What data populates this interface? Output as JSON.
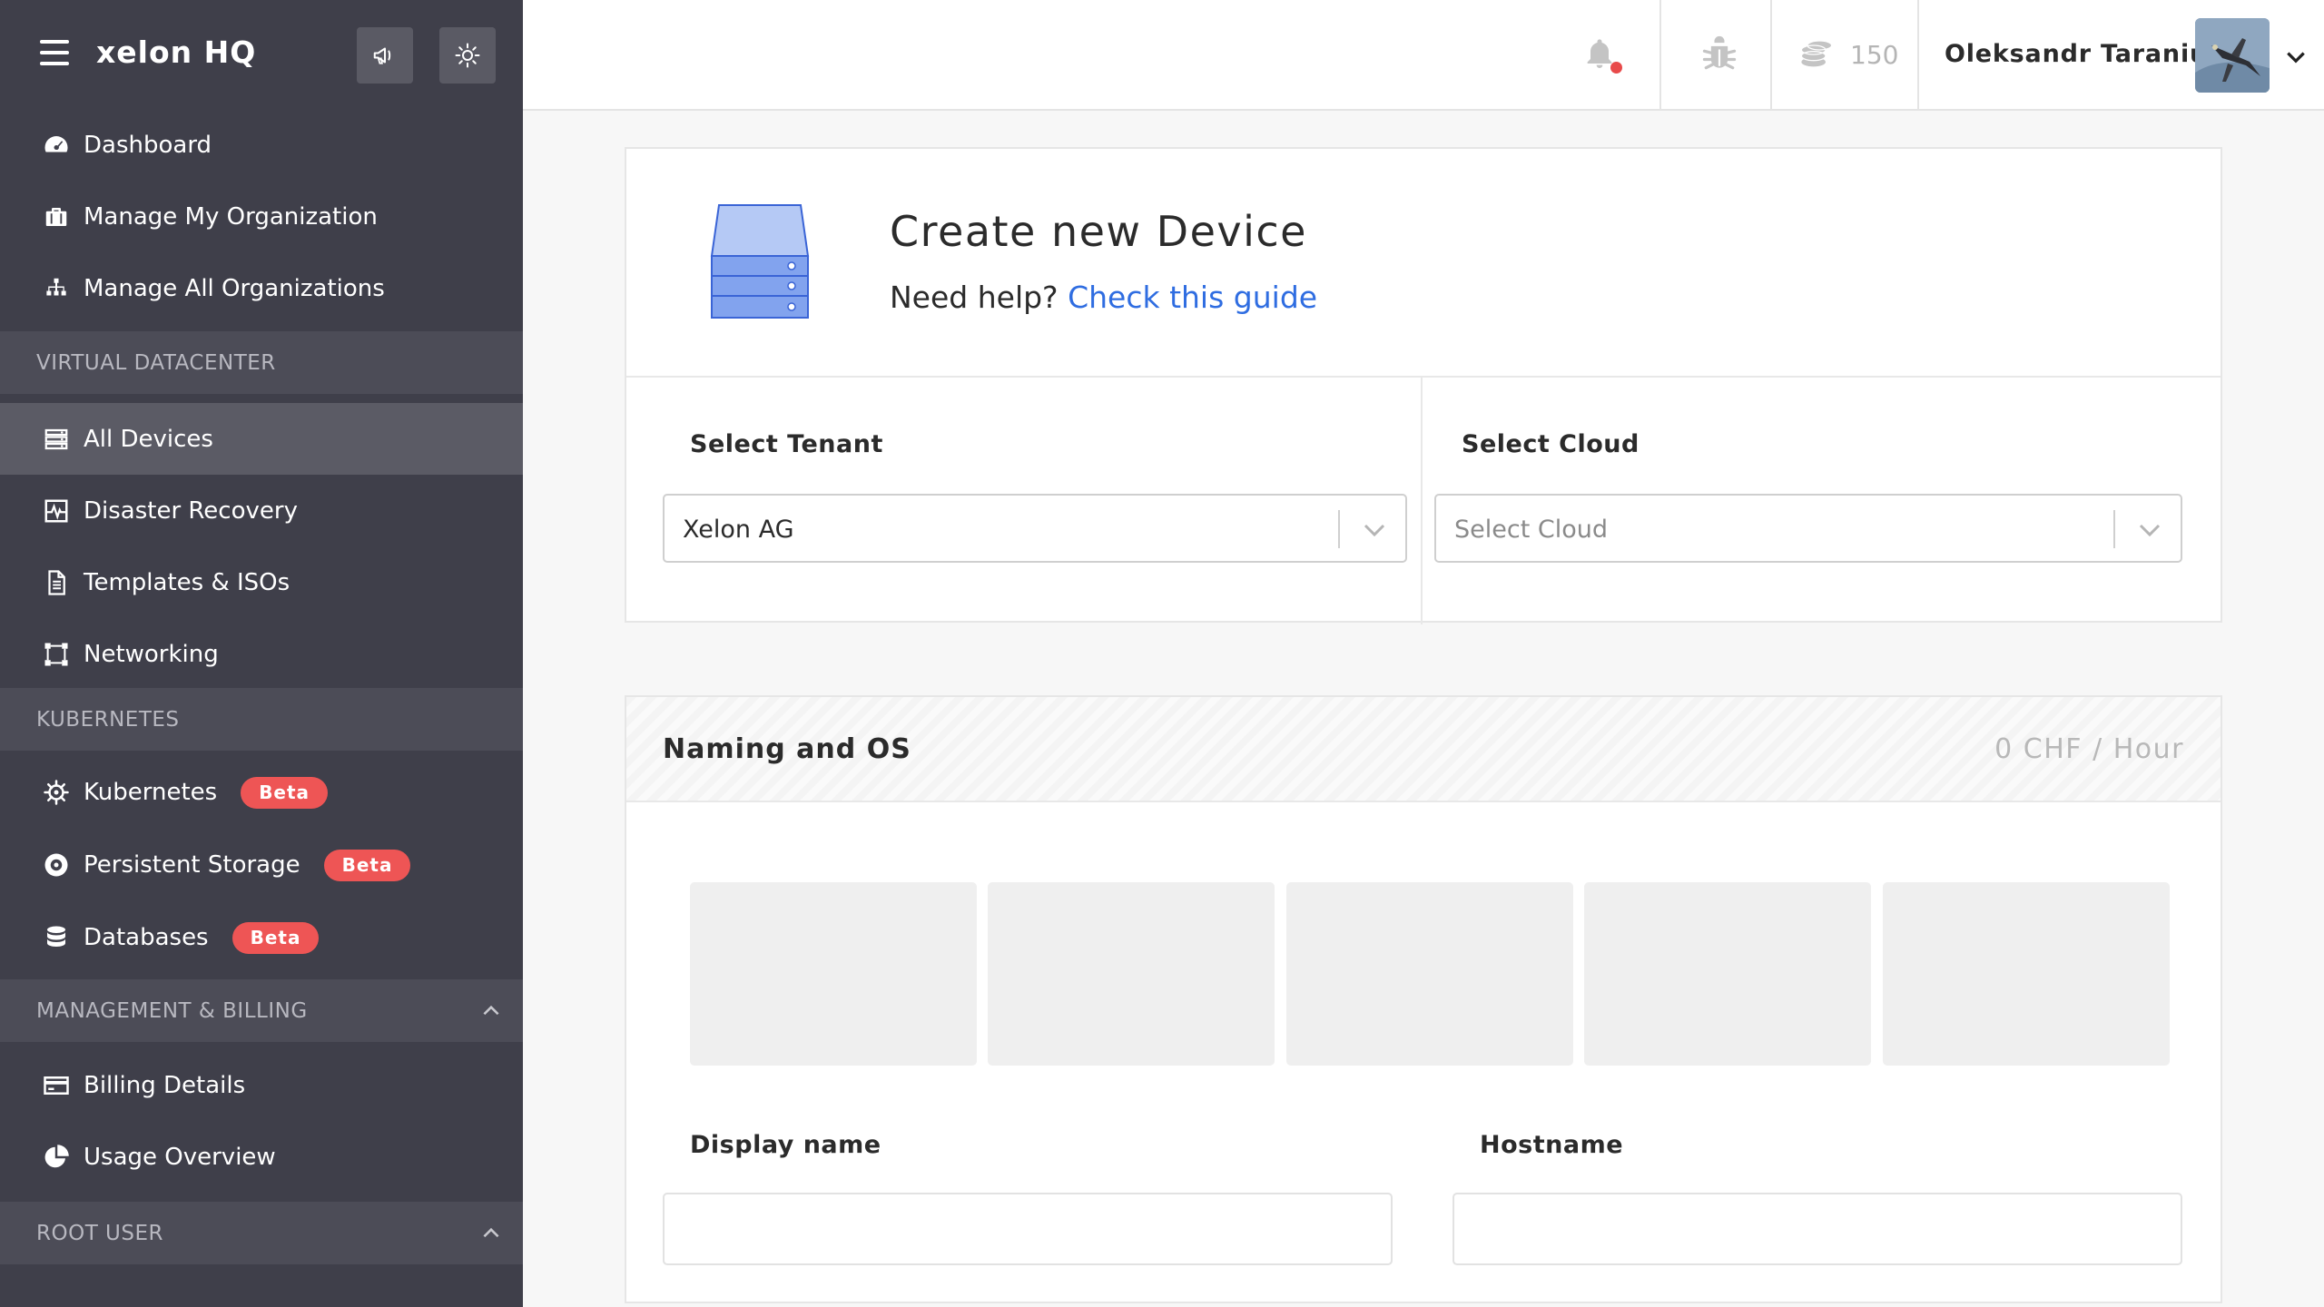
{
  "sidebar": {
    "brand": "xelon HQ",
    "items_top": [
      {
        "label": "Dashboard",
        "icon": "dashboard-icon"
      },
      {
        "label": "Manage My Organization",
        "icon": "briefcase-icon"
      },
      {
        "label": "Manage All Organizations",
        "icon": "sitemap-icon"
      }
    ],
    "sections": {
      "vdc": "VIRTUAL DATACENTER",
      "k8s": "KUBERNETES",
      "billing": "MANAGEMENT & BILLING",
      "root": "ROOT USER"
    },
    "items_vdc": [
      {
        "label": "All Devices",
        "icon": "server-icon",
        "active": true
      },
      {
        "label": "Disaster Recovery",
        "icon": "heartbeat-icon"
      },
      {
        "label": "Templates & ISOs",
        "icon": "file-icon"
      },
      {
        "label": "Networking",
        "icon": "network-icon"
      }
    ],
    "items_k8s": [
      {
        "label": "Kubernetes",
        "icon": "helm-icon",
        "badge": "Beta"
      },
      {
        "label": "Persistent Storage",
        "icon": "disk-icon",
        "badge": "Beta"
      },
      {
        "label": "Databases",
        "icon": "database-icon",
        "badge": "Beta"
      }
    ],
    "items_billing": [
      {
        "label": "Billing Details",
        "icon": "credit-card-icon"
      },
      {
        "label": "Usage Overview",
        "icon": "pie-chart-icon"
      }
    ]
  },
  "topbar": {
    "credits": "150",
    "username": "Oleksandr Taraniuk"
  },
  "create": {
    "title": "Create new Device",
    "help_prefix": "Need help?",
    "help_link": "Check this guide",
    "tenant_label": "Select Tenant",
    "tenant_value": "Xelon AG",
    "cloud_label": "Select Cloud",
    "cloud_placeholder": "Select Cloud"
  },
  "naming": {
    "title": "Naming and OS",
    "price": "0 CHF / Hour",
    "display_name_label": "Display name",
    "hostname_label": "Hostname"
  },
  "colors": {
    "sidebar_bg": "#3f3f4a",
    "link": "#2f6de1",
    "badge": "#ee5555"
  }
}
